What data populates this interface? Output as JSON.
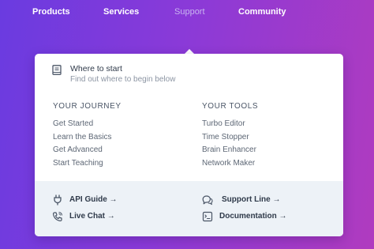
{
  "nav": {
    "items": [
      {
        "label": "Products"
      },
      {
        "label": "Services"
      },
      {
        "label": "Support"
      },
      {
        "label": "Community"
      }
    ],
    "active": "Support"
  },
  "dropdown": {
    "intro": {
      "title": "Where to start",
      "subtitle": "Find out where to begin below",
      "icon": "book-icon"
    },
    "journey": {
      "heading": "YOUR JOURNEY",
      "links": [
        "Get Started",
        "Learn the Basics",
        "Get Advanced",
        "Start Teaching"
      ]
    },
    "tools": {
      "heading": "YOUR TOOLS",
      "links": [
        "Turbo Editor",
        "Time Stopper",
        "Brain Enhancer",
        "Network Maker"
      ]
    },
    "footer": {
      "api": {
        "label": "API Guide →",
        "icon": "plug-icon"
      },
      "chat": {
        "label": "Live Chat →",
        "icon": "phone-icon"
      },
      "support": {
        "label": "Support Line →",
        "icon": "chat-bubbles-icon"
      },
      "docs": {
        "label": "Documentation →",
        "icon": "document-icon"
      }
    }
  },
  "colors": {
    "background_start": "#6a3be0",
    "background_end": "#b03bbf",
    "panel": "#ffffff",
    "footer": "#edf2f7",
    "active_nav": "#c9b5f0"
  }
}
